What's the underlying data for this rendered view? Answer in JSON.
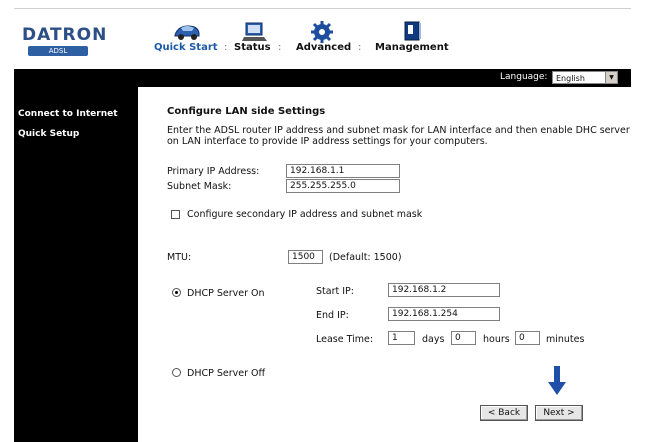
{
  "brand": {
    "name": "DATRON",
    "sub": "ADSL"
  },
  "nav": {
    "items": [
      {
        "label": "Quick Start",
        "icon": "car-icon"
      },
      {
        "label": "Status",
        "icon": "monitor-icon"
      },
      {
        "label": "Advanced",
        "icon": "gear-icon"
      },
      {
        "label": "Management",
        "icon": "book-icon"
      }
    ],
    "separator": ":"
  },
  "language": {
    "label": "Language:",
    "value": "English"
  },
  "sidebar": {
    "items": [
      {
        "label": "Connect to Internet"
      },
      {
        "label": "Quick Setup"
      }
    ]
  },
  "form": {
    "title": "Configure LAN side Settings",
    "description": "Enter the ADSL router IP address and subnet mask for LAN interface and then enable DHC server on LAN interface to provide IP address settings for your computers.",
    "primary_ip_label": "Primary IP Address:",
    "primary_ip_value": "192.168.1.1",
    "subnet_label": "Subnet Mask:",
    "subnet_value": "255.255.255.0",
    "secondary_label": "Configure secondary IP address and subnet mask",
    "mtu_label": "MTU:",
    "mtu_value": "1500",
    "mtu_default": "(Default: 1500)",
    "dhcp_on_label": "DHCP Server On",
    "start_ip_label": "Start IP:",
    "start_ip_value": "192.168.1.2",
    "end_ip_label": "End IP:",
    "end_ip_value": "192.168.1.254",
    "lease_label": "Lease Time:",
    "lease_days_value": "1",
    "days_label": "days",
    "lease_hours_value": "0",
    "hours_label": "hours",
    "lease_minutes_value": "0",
    "minutes_label": "minutes",
    "dhcp_off_label": "DHCP Server Off",
    "back_label": "< Back",
    "next_label": "Next >"
  },
  "colors": {
    "brand": "#2c4f86",
    "nav_active": "#1c5aa8",
    "bar": "#000000",
    "arrow": "#1f4fa8"
  }
}
